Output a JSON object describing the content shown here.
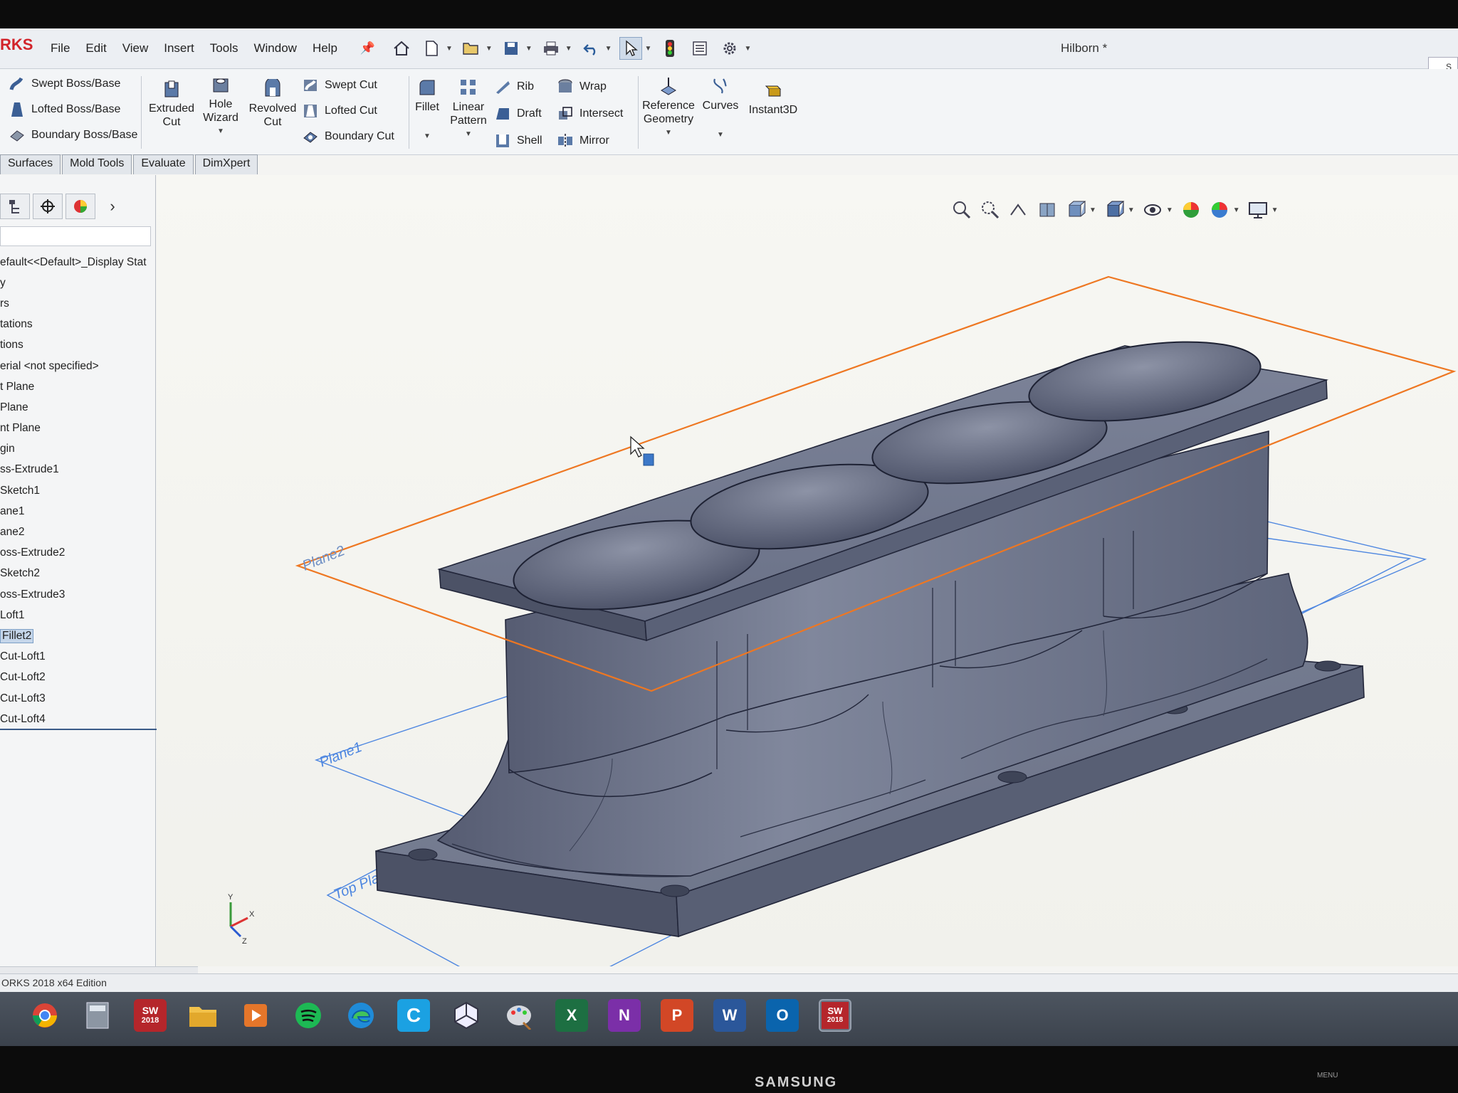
{
  "app": {
    "logo": "RKS",
    "doc_title": "Hilborn *",
    "help_hint": "S"
  },
  "menu": [
    "File",
    "Edit",
    "View",
    "Insert",
    "Tools",
    "Window",
    "Help"
  ],
  "ribbon": {
    "boss_group": [
      "Swept Boss/Base",
      "Lofted Boss/Base",
      "Boundary Boss/Base"
    ],
    "extruded_cut": "Extruded\nCut",
    "hole_wizard": "Hole\nWizard",
    "revolved_cut": "Revolved\nCut",
    "cut_group": [
      "Swept Cut",
      "Lofted Cut",
      "Boundary Cut"
    ],
    "fillet": "Fillet",
    "linear_pattern": "Linear\nPattern",
    "feature_col1": [
      "Rib",
      "Draft",
      "Shell"
    ],
    "feature_col2": [
      "Wrap",
      "Intersect",
      "Mirror"
    ],
    "reference_geometry": "Reference\nGeometry",
    "curves": "Curves",
    "instant3d": "Instant3D"
  },
  "tabs": [
    "Surfaces",
    "Mold Tools",
    "Evaluate",
    "DimXpert"
  ],
  "tree": [
    "efault<<Default>_Display Stat",
    "y",
    "rs",
    "tations",
    "tions",
    "erial <not specified>",
    "t Plane",
    " Plane",
    "nt Plane",
    "gin",
    "ss-Extrude1",
    " Sketch1",
    "ane1",
    "ane2",
    "oss-Extrude2",
    "  Sketch2",
    "oss-Extrude3",
    "Loft1",
    "Fillet2",
    " Cut-Loft1",
    " Cut-Loft2",
    "  Cut-Loft3",
    " Cut-Loft4"
  ],
  "selected_tree_item": "Fillet2",
  "viewport": {
    "plane_labels": [
      "Plane2",
      "Plane1",
      "Top Plane"
    ],
    "triad": {
      "x": "X",
      "y": "Y",
      "z": "Z"
    }
  },
  "status_bar": "ORKS 2018 x64 Edition",
  "taskbar": [
    "chrome-icon",
    "calculator-icon",
    "solidworks-icon",
    "file-explorer-icon",
    "media-player-icon",
    "spotify-icon",
    "edge-icon",
    "c-app-icon",
    "3d-app-icon",
    "paint-icon",
    "excel-icon",
    "onenote-icon",
    "powerpoint-icon",
    "word-icon",
    "outlook-icon",
    "solidworks-active-icon"
  ],
  "taskbar_labels": {
    "sw_year": "2018",
    "excel": "X",
    "onenote": "N",
    "powerpoint": "P",
    "word": "W",
    "outlook": "O",
    "c_app": "C"
  },
  "monitor_brand": "SAMSUNG",
  "monitor_menu": "MENU",
  "colors": {
    "plane_selected": "#ee7722",
    "plane_normal": "#4d86e0",
    "part_steel": "#6f768c",
    "accent_red": "#d2232a"
  }
}
